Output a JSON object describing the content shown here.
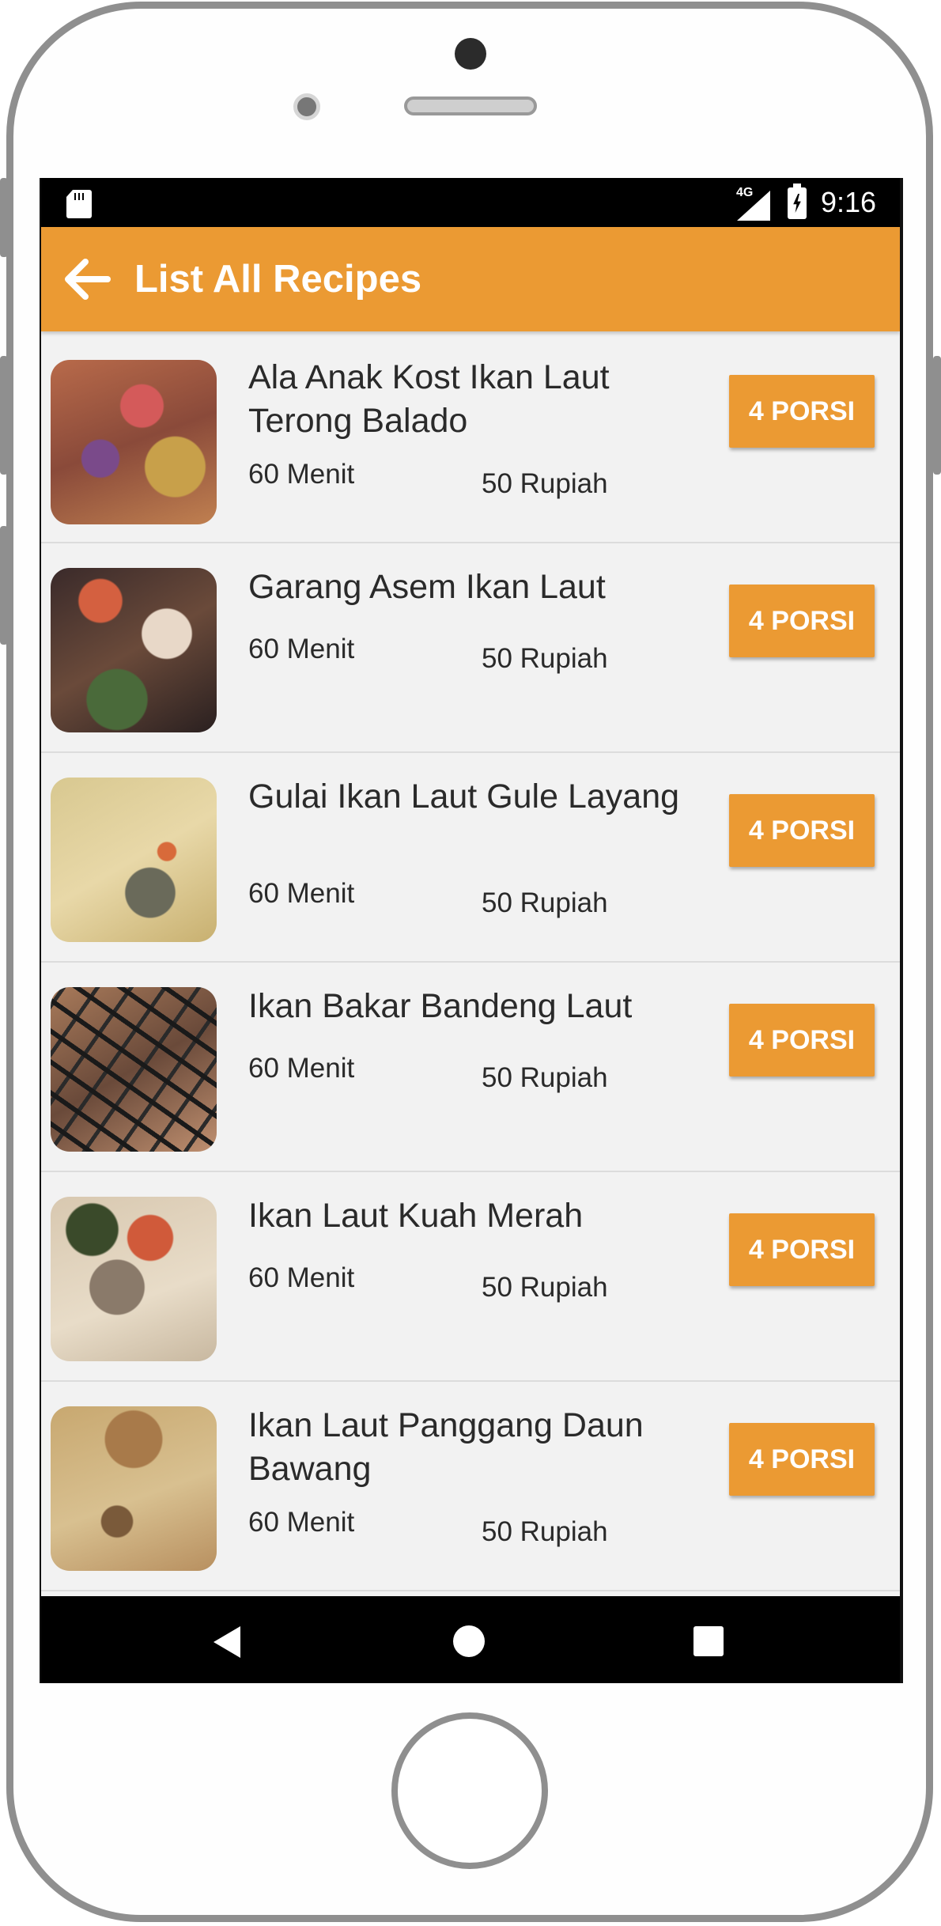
{
  "status_bar": {
    "network": "4G",
    "time": "9:16"
  },
  "app_bar": {
    "title": "List All Recipes"
  },
  "recipes": [
    {
      "title": "Ala Anak Kost  Ikan Laut Terong Balado",
      "time": "60 Menit",
      "price": "50 Rupiah",
      "portion": "4 PORSI"
    },
    {
      "title": "Garang Asem Ikan Laut",
      "time": "60 Menit",
      "price": "50 Rupiah",
      "portion": "4 PORSI"
    },
    {
      "title": "Gulai Ikan Laut  Gule Layang",
      "time": "60 Menit",
      "price": "50 Rupiah",
      "portion": "4 PORSI"
    },
    {
      "title": "Ikan Bakar Bandeng Laut",
      "time": "60 Menit",
      "price": "50 Rupiah",
      "portion": "4 PORSI"
    },
    {
      "title": "Ikan Laut Kuah Merah",
      "time": "60 Menit",
      "price": "50 Rupiah",
      "portion": "4 PORSI"
    },
    {
      "title": "Ikan Laut Panggang Daun Bawang",
      "time": "60 Menit",
      "price": "50 Rupiah",
      "portion": "4 PORSI"
    }
  ],
  "colors": {
    "accent": "#eb9a33",
    "list_background": "#f2f2f2"
  }
}
